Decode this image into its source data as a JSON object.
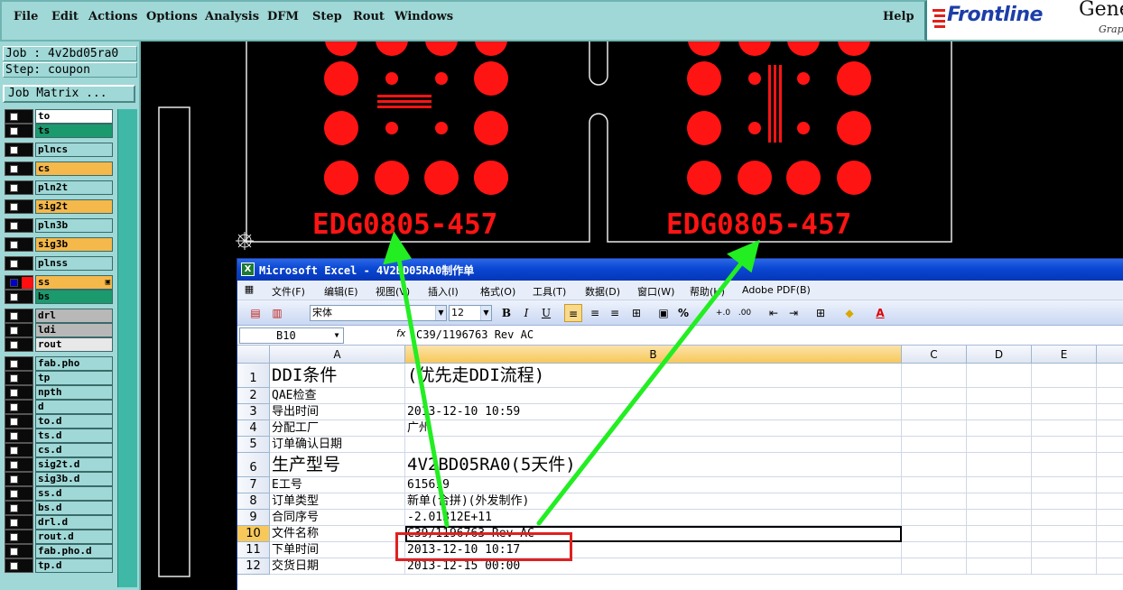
{
  "genesis": {
    "menu": [
      "File",
      "Edit",
      "Actions",
      "Options",
      "Analysis",
      "DFM",
      "Step",
      "Rout",
      "Windows"
    ],
    "help": "Help",
    "logo": {
      "brand": "Frontline",
      "product": "Gene",
      "sub": "Grap"
    },
    "job_label": "Job : 4v2bd05ra0",
    "step_label": "Step: coupon",
    "job_matrix": "Job Matrix ...",
    "layers": [
      {
        "name": "to",
        "checked": false,
        "swatch": "",
        "bg": "#ffffff"
      },
      {
        "name": "ts",
        "checked": false,
        "swatch": "",
        "bg": "#1b9a6e"
      },
      {
        "name": "plncs",
        "checked": false,
        "swatch": "",
        "bg": "#9fd8d6"
      },
      {
        "name": "cs",
        "checked": false,
        "swatch": "",
        "bg": "#f5b84a"
      },
      {
        "name": "pln2t",
        "checked": false,
        "swatch": "",
        "bg": "#9fd8d6"
      },
      {
        "name": "sig2t",
        "checked": false,
        "swatch": "",
        "bg": "#f5b84a"
      },
      {
        "name": "pln3b",
        "checked": false,
        "swatch": "",
        "bg": "#9fd8d6"
      },
      {
        "name": "sig3b",
        "checked": false,
        "swatch": "",
        "bg": "#f5b84a"
      },
      {
        "name": "plnss",
        "checked": false,
        "swatch": "",
        "bg": "#9fd8d6"
      },
      {
        "name": "ss",
        "checked": true,
        "swatch": "#ff1010",
        "bg": "#f5b84a",
        "mark": "▣"
      },
      {
        "name": "bs",
        "checked": false,
        "swatch": "",
        "bg": "#1b9a6e"
      },
      {
        "name": "drl",
        "checked": false,
        "swatch": "",
        "bg": "#b8b8b8"
      },
      {
        "name": "ldi",
        "checked": false,
        "swatch": "",
        "bg": "#b8b8b8"
      },
      {
        "name": "rout",
        "checked": false,
        "swatch": "",
        "bg": "#e8e8e8"
      },
      {
        "name": "fab.pho",
        "checked": false,
        "swatch": "",
        "bg": "#9fd8d6"
      },
      {
        "name": "tp",
        "checked": false,
        "swatch": "",
        "bg": "#9fd8d6"
      },
      {
        "name": "npth",
        "checked": false,
        "swatch": "",
        "bg": "#9fd8d6"
      },
      {
        "name": "d",
        "checked": false,
        "swatch": "",
        "bg": "#9fd8d6"
      },
      {
        "name": "to.d",
        "checked": false,
        "swatch": "",
        "bg": "#9fd8d6"
      },
      {
        "name": "ts.d",
        "checked": false,
        "swatch": "",
        "bg": "#9fd8d6"
      },
      {
        "name": "cs.d",
        "checked": false,
        "swatch": "",
        "bg": "#9fd8d6"
      },
      {
        "name": "sig2t.d",
        "checked": false,
        "swatch": "",
        "bg": "#9fd8d6"
      },
      {
        "name": "sig3b.d",
        "checked": false,
        "swatch": "",
        "bg": "#9fd8d6"
      },
      {
        "name": "ss.d",
        "checked": false,
        "swatch": "",
        "bg": "#9fd8d6"
      },
      {
        "name": "bs.d",
        "checked": false,
        "swatch": "",
        "bg": "#9fd8d6"
      },
      {
        "name": "drl.d",
        "checked": false,
        "swatch": "",
        "bg": "#9fd8d6"
      },
      {
        "name": "rout.d",
        "checked": false,
        "swatch": "",
        "bg": "#9fd8d6"
      },
      {
        "name": "fab.pho.d",
        "checked": false,
        "swatch": "",
        "bg": "#9fd8d6"
      },
      {
        "name": "tp.d",
        "checked": false,
        "swatch": "",
        "bg": "#9fd8d6"
      }
    ],
    "canvas_text_left": "EDG0805-457",
    "canvas_text_right": "EDG0805-457",
    "pad_color": "#ff1414"
  },
  "excel": {
    "title": "Microsoft Excel - 4V2BD05RA0制作单",
    "menu": [
      "文件(F)",
      "编辑(E)",
      "视图(V)",
      "插入(I)",
      "格式(O)",
      "工具(T)",
      "数据(D)",
      "窗口(W)",
      "帮助(H)",
      "Adobe PDF(B)"
    ],
    "font_name": "宋体",
    "font_size": "12",
    "name_box": "B10",
    "fx": "fx",
    "formula": "C39/1196763 Rev AC",
    "columns": [
      "A",
      "B",
      "C",
      "D",
      "E"
    ],
    "rows": [
      {
        "n": "1",
        "a": "DDI条件",
        "b": "(优先走DDI流程)",
        "big": true
      },
      {
        "n": "2",
        "a": "QAE检查",
        "b": ""
      },
      {
        "n": "3",
        "a": "导出时间",
        "b": "2013-12-10 10:59"
      },
      {
        "n": "4",
        "a": "分配工厂",
        "b": "广州"
      },
      {
        "n": "5",
        "a": "订单确认日期",
        "b": ""
      },
      {
        "n": "6",
        "a": "生产型号",
        "b": "4V2BD05RA0(5天件)",
        "big": true
      },
      {
        "n": "7",
        "a": "E工号",
        "b": "615619"
      },
      {
        "n": "8",
        "a": "订单类型",
        "b": "新单(合拼)(外发制作)"
      },
      {
        "n": "9",
        "a": "合同序号",
        "b": "-2.01312E+11"
      },
      {
        "n": "10",
        "a": "文件名称",
        "b": "C39/1196763 Rev AC",
        "sel": true
      },
      {
        "n": "11",
        "a": "下单时间",
        "b": "2013-12-10 10:17"
      },
      {
        "n": "12",
        "a": "交货日期",
        "b": "2013-12-15 00:00"
      }
    ],
    "toolbar_icons": [
      "save-icon",
      "pdf-icon",
      "pdf-export-icon",
      "bold-icon",
      "italic-icon",
      "underline-icon",
      "align-left-icon",
      "align-center-icon",
      "align-right-icon",
      "merge-icon",
      "currency-icon",
      "percent-icon",
      "increase-decimal-icon",
      "decrease-decimal-icon",
      "decrease-indent-icon",
      "increase-indent-icon",
      "borders-icon",
      "fill-color-icon",
      "font-color-icon"
    ]
  },
  "annotation": {
    "arrow_color": "#22ee22",
    "box_color": "#e02020"
  }
}
